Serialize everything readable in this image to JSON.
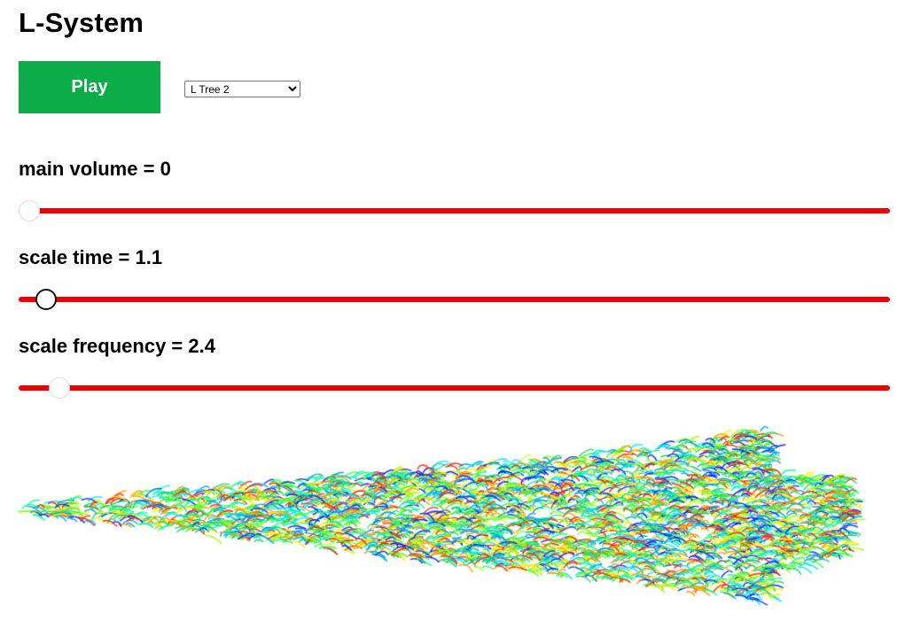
{
  "app": {
    "title": "L-System"
  },
  "controls": {
    "play_label": "Play",
    "preset": {
      "selected": "L Tree 2"
    }
  },
  "sliders": [
    {
      "name": "main volume",
      "value": "0",
      "fraction": 0.0,
      "thumb_style": "faint"
    },
    {
      "name": "scale time",
      "value": "1.1",
      "fraction": 0.02,
      "thumb_style": "dark"
    },
    {
      "name": "scale frequency",
      "value": "2.4",
      "fraction": 0.035,
      "thumb_style": "faint"
    }
  ],
  "separator": " = ",
  "colors": {
    "play_button": "#0cac48",
    "slider_track": "#ee0000",
    "stroke_palette": [
      "#0022ff",
      "#0099ff",
      "#00e5ff",
      "#00ff99",
      "#33ff33",
      "#99ff00",
      "#ffee00",
      "#ff9900",
      "#ff2200",
      "#22cc66"
    ]
  }
}
